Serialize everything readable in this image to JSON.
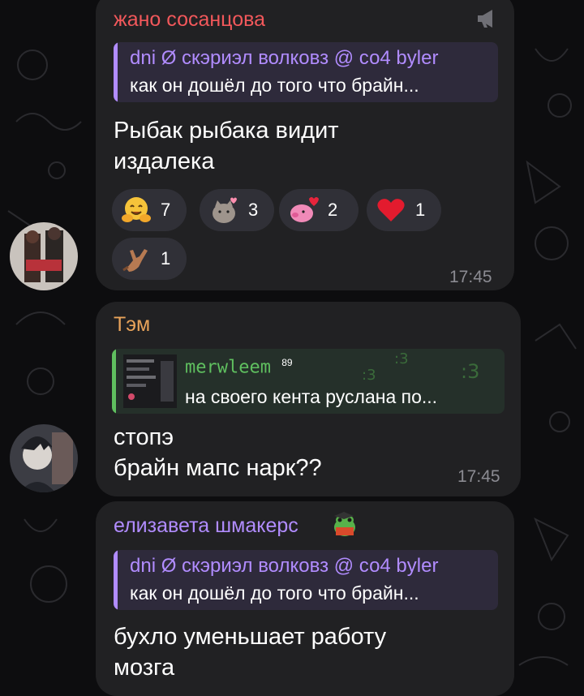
{
  "colors": {
    "bubble": "#212123",
    "name_red": "#f2585b",
    "name_orange": "#e8a35a",
    "name_purple": "#b18cff",
    "reply_purple_bg": "#2e2a3b",
    "reply_green": "#5fbf5f",
    "reply_green_bg": "#25302a",
    "text": "#ffffff",
    "time": "#8b8b92",
    "reaction_bg": "#303037"
  },
  "messages": [
    {
      "sender": "жано сосанцова",
      "reply_name": "dni Ø скэриэл волковз @ со4 byler",
      "reply_text": "как он дошёл до того что брайн...",
      "text": "Рыбак рыбака видит\nиздалека",
      "time": "17:45",
      "reactions": [
        {
          "icon": "hugging-face-icon",
          "count": "7"
        },
        {
          "icon": "pusheen-cat-icon",
          "count": "3"
        },
        {
          "icon": "pink-pig-heart-icon",
          "count": "2"
        },
        {
          "icon": "red-heart-icon",
          "count": "1"
        },
        {
          "icon": "rock-hand-icon",
          "count": "1"
        }
      ]
    },
    {
      "sender": "Тэм",
      "reply_name": "merwleem",
      "reply_badge": "89",
      "reply_text": "на своего кента руслана по...",
      "text": "стопэ\nбрайн мапс нарк??",
      "time": "17:45"
    },
    {
      "sender": "елизавета шмакерс",
      "sender_badge_icon": "frog-reading-book-icon",
      "reply_name": "dni Ø скэриэл волковз @ со4 byler",
      "reply_text": "как он дошёл до того что брайн...",
      "text": "бухло уменьшает работу\nмозга"
    }
  ]
}
